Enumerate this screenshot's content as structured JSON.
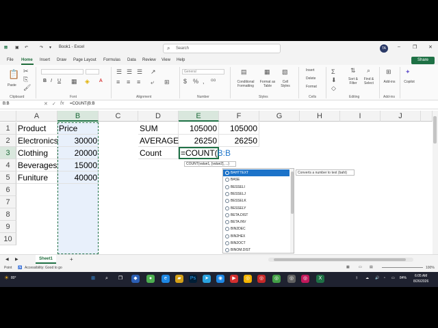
{
  "title_bar": {
    "autosave_icon": "autosave-icon",
    "save_icon": "save-icon",
    "undo_icon": "undo-icon",
    "redo_icon": "redo-icon",
    "workbook_title": "Book1 - Excel",
    "search_placeholder": "Search",
    "user_initials": "TA",
    "minimize": "–",
    "maximize": "❐",
    "close": "✕"
  },
  "menu": {
    "items": [
      "File",
      "Home",
      "Insert",
      "Draw",
      "Page Layout",
      "Formulas",
      "Data",
      "Review",
      "View",
      "Help"
    ],
    "active": "Home",
    "share_label": "Share"
  },
  "ribbon": {
    "paste_label": "Paste",
    "font_name_placeholder": "",
    "number_format": "General",
    "insert_label": "Insert",
    "delete_label": "Delete",
    "format_label": "Format",
    "conditional_formatting": "Conditional Formatting",
    "format_as_table": "Format as Table",
    "cell_styles": "Cell Styles",
    "sort_filter": "Sort & Filter",
    "find_select": "Find & Select",
    "add_ins": "Add-ins",
    "copilot": "Copilot",
    "groups": [
      "Clipboard",
      "Font",
      "Alignment",
      "Number",
      "Styles",
      "Cells",
      "Editing",
      "Add-ins"
    ]
  },
  "formula_bar": {
    "name_box": "B:B",
    "cancel": "✕",
    "enter": "✓",
    "fx": "fx",
    "formula": "=COUNT(B:B"
  },
  "columns": [
    "A",
    "B",
    "C",
    "D",
    "E",
    "F",
    "G",
    "H",
    "I",
    "J"
  ],
  "rows": [
    "1",
    "2",
    "3",
    "4",
    "5",
    "6",
    "7",
    "8",
    "9",
    "10"
  ],
  "cells": {
    "A1": "Product",
    "B1": "Price",
    "A2": "Electronics",
    "B2": "30000",
    "A3": "Clothing",
    "B3": "20000",
    "A4": "Beverages",
    "B4": "15000",
    "A5": "Funiture",
    "B5": "40000",
    "D1": "SUM",
    "E1": "105000",
    "F1": "105000",
    "D2": "AVERAGE",
    "E2": "26250",
    "F2": "26250",
    "D3": "Count",
    "E3_prefix": "=COUNT(",
    "E3_ref": "B:B"
  },
  "autocomplete": {
    "signature": "COUNT(value1, [value2], ...)",
    "items": [
      "BAHTTEXT",
      "BASE",
      "BESSELI",
      "BESSELJ",
      "BESSELK",
      "BESSELY",
      "BETA.DIST",
      "BETA.INV",
      "BIN2DEC",
      "BIN2HEX",
      "BIN2OCT",
      "BINOM.DIST"
    ],
    "selected": "BAHTTEXT",
    "description": "Converts a number to text (baht)"
  },
  "sheets": {
    "tabs": [
      "Sheet1"
    ],
    "add": "+"
  },
  "status": {
    "mode": "Point",
    "accessibility": "Accessibility: Good to go",
    "zoom": "100%"
  },
  "taskbar": {
    "weather": "80°",
    "time": "6:05 AM",
    "date": "8/26/2026",
    "battery": "84%"
  },
  "colors": {
    "accent": "#1e7145",
    "selection": "#1c73c9"
  }
}
